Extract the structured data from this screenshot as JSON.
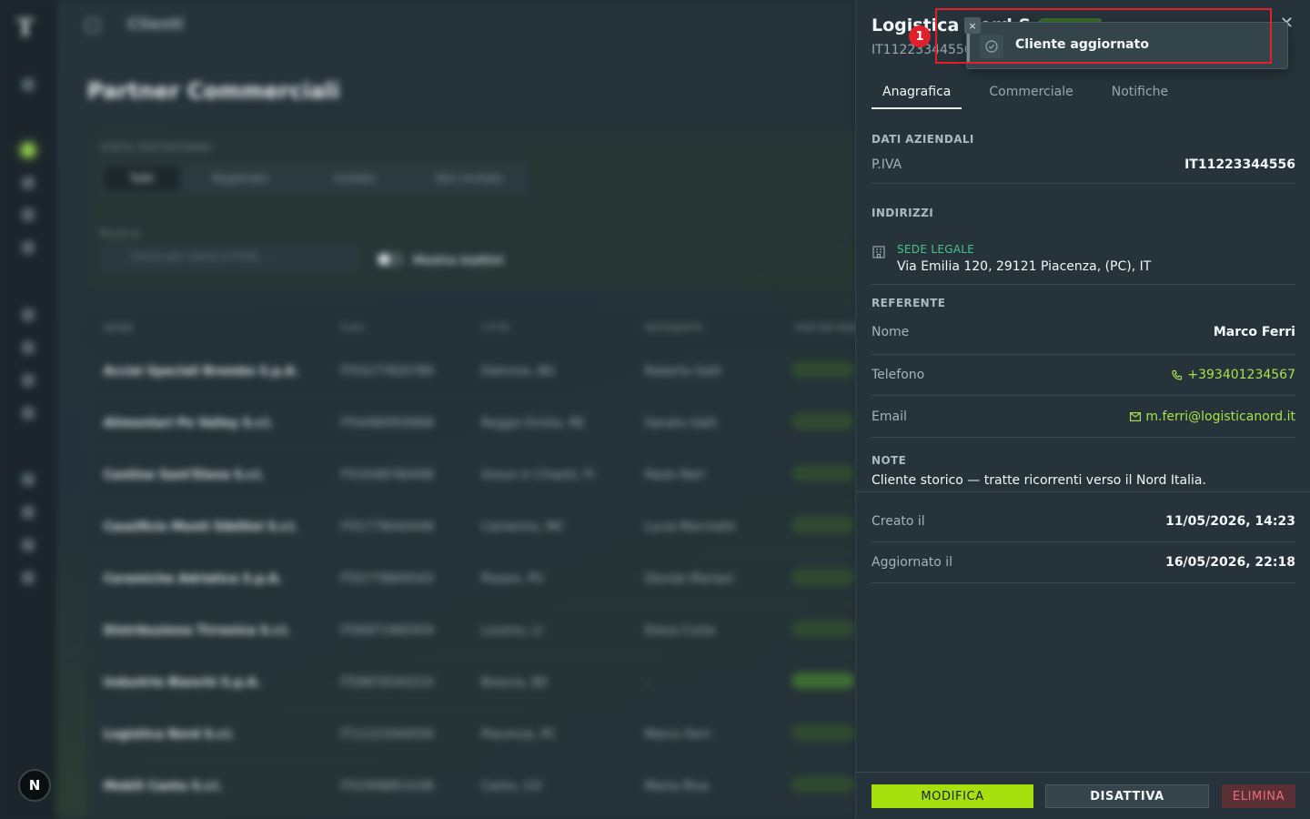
{
  "background": {
    "app_logo": "T",
    "breadcrumb": "Clienti",
    "page_title": "Partner Commerciali",
    "filters": {
      "state_label": "STATO PIATTAFORMA",
      "segments": [
        "Tutti",
        "Registrato",
        "Invitato",
        "Non invitato"
      ],
      "search_label": "Ricerca",
      "search_placeholder": "Cerca per nome o P.IVA...",
      "toggle_label": "Mostra inattivi"
    },
    "table": {
      "headers": [
        "NOME",
        "P.IVA",
        "CITTÀ",
        "REFERENTE",
        "PIATTAFORMA"
      ],
      "rows": [
        {
          "name": "Acciai Speciali Brembo S.p.A.",
          "piva": "IT03277820789",
          "city": "Dalmine, BG",
          "ref": "Roberto Galli"
        },
        {
          "name": "Alimentari Po Valley S.r.l.",
          "piva": "IT04480959968",
          "city": "Reggio Emilia, RE",
          "ref": "Sandro Galli"
        },
        {
          "name": "Cantine Sant'Elena S.r.l.",
          "piva": "IT03598780498",
          "city": "Greve in Chianti, FI",
          "ref": "Paolo Neri"
        },
        {
          "name": "Caseificio Monti Sibillini S.r.l.",
          "piva": "IT01778040448",
          "city": "Camerino, MC",
          "ref": "Lucia Marchetti"
        },
        {
          "name": "Ceramiche Adriatica S.p.A.",
          "piva": "IT02778840543",
          "city": "Pesaro, PU",
          "ref": "Davide Mariani"
        },
        {
          "name": "Distribuzione Tirrenica S.r.l.",
          "piva": "IT06871985959",
          "city": "Livorno, LI",
          "ref": "Elena Costa"
        },
        {
          "name": "Industrie Bianchi S.p.A.",
          "piva": "IT09876543210",
          "city": "Brescia, BS",
          "ref": "-"
        },
        {
          "name": "Logistica Nord S.r.l.",
          "piva": "IT11223344556",
          "city": "Piacenza, PC",
          "ref": "Marco Ferri"
        },
        {
          "name": "Mobili Cantu S.r.l.",
          "piva": "IT02998851038",
          "city": "Cantu, CO",
          "ref": "Marta Riva"
        }
      ]
    },
    "dev_badge": "N"
  },
  "panel": {
    "title": "Logistica Nord S.r.l.",
    "subtitle": "IT11223344556",
    "close_icon": "close-icon",
    "tabs": [
      "Anagrafica",
      "Commerciale",
      "Notifiche"
    ],
    "active_tab": 0,
    "dati_aziendali": {
      "heading": "DATI AZIENDALI",
      "piva_label": "P.IVA",
      "piva_value": "IT11223344556"
    },
    "indirizzi": {
      "heading": "INDIRIZZI",
      "tag": "SEDE LEGALE",
      "address": "Via Emilia 120, 29121 Piacenza, (PC), IT"
    },
    "referente": {
      "heading": "REFERENTE",
      "name_label": "Nome",
      "name_value": "Marco Ferri",
      "phone_label": "Telefono",
      "phone_value": "+393401234567",
      "email_label": "Email",
      "email_value": "m.ferri@logisticanord.it"
    },
    "note": {
      "heading": "NOTE",
      "text": "Cliente storico — tratte ricorrenti verso il Nord Italia."
    },
    "meta": {
      "created_label": "Creato il",
      "created_value": "11/05/2026, 14:23",
      "updated_label": "Aggiornato il",
      "updated_value": "16/05/2026, 22:18"
    },
    "actions": {
      "edit": "MODIFICA",
      "deactivate": "DISATTIVA",
      "delete": "ELIMINA"
    }
  },
  "toast": {
    "message": "Cliente aggiornato",
    "close_glyph": "×",
    "marker_number": "1"
  },
  "colors": {
    "accent": "#a6e10f",
    "link": "#a7e14b",
    "tag_green": "#4cc38a",
    "danger": "#ef6b77",
    "highlight": "#e0202a"
  }
}
